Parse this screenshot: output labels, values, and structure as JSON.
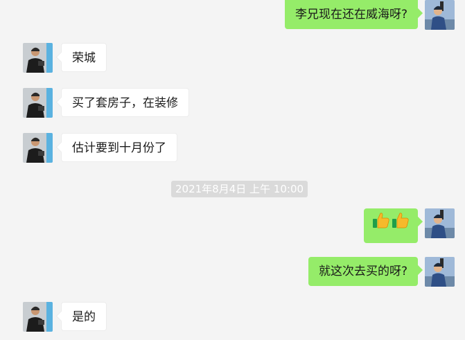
{
  "chat": {
    "messages": [
      {
        "id": "m1",
        "direction": "out",
        "text": "李兄现在还在威海呀?"
      },
      {
        "id": "m2",
        "direction": "in",
        "text": "荣城"
      },
      {
        "id": "m3",
        "direction": "in",
        "text": "买了套房子，在装修"
      },
      {
        "id": "m4",
        "direction": "in",
        "text": "估计要到十月份了"
      },
      {
        "id": "m5",
        "direction": "out",
        "emoji": [
          "thumbs-up-icon",
          "thumbs-up-icon"
        ]
      },
      {
        "id": "m6",
        "direction": "out",
        "text": "就这次去买的呀?"
      },
      {
        "id": "m7",
        "direction": "in",
        "text": "是的"
      }
    ],
    "timestamp": "2021年8月4日 上午 10:00"
  },
  "colors": {
    "background": "#f4f4f4",
    "outgoing_bubble": "#95ec69",
    "incoming_bubble": "#ffffff",
    "timestamp_bg": "#dadada"
  }
}
